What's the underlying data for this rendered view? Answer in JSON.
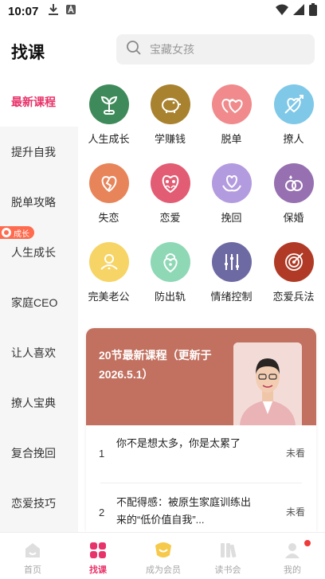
{
  "status_bar": {
    "time": "10:07"
  },
  "header": {
    "title": "找课",
    "search_placeholder": "宝藏女孩"
  },
  "sidebar": {
    "items": [
      {
        "label": "最新课程"
      },
      {
        "label": "提升自我"
      },
      {
        "label": "脱单攻略"
      },
      {
        "label": "人生成长"
      },
      {
        "label": "家庭CEO"
      },
      {
        "label": "让人喜欢"
      },
      {
        "label": "撩人宝典"
      },
      {
        "label": "复合挽回"
      },
      {
        "label": "恋爱技巧"
      }
    ],
    "badge": "成长"
  },
  "categories": [
    {
      "label": "人生成长",
      "icon": "sprout-icon",
      "color": "#3f8a5a"
    },
    {
      "label": "学赚钱",
      "icon": "piggy-bank-icon",
      "color": "#a8822f"
    },
    {
      "label": "脱单",
      "icon": "two-hearts-icon",
      "color": "#f08a8c"
    },
    {
      "label": "撩人",
      "icon": "arrow-heart-icon",
      "color": "#7fc8e8"
    },
    {
      "label": "失恋",
      "icon": "broken-heart-icon",
      "color": "#e8845a"
    },
    {
      "label": "恋爱",
      "icon": "couple-icon",
      "color": "#e25c73"
    },
    {
      "label": "挽回",
      "icon": "heart-hands-icon",
      "color": "#b39be0"
    },
    {
      "label": "保婚",
      "icon": "rings-icon",
      "color": "#9670b0"
    },
    {
      "label": "完美老公",
      "icon": "husband-icon",
      "color": "#f6d465"
    },
    {
      "label": "防出轨",
      "icon": "heart-lock-icon",
      "color": "#8ed8b5"
    },
    {
      "label": "情绪控制",
      "icon": "sliders-icon",
      "color": "#6d6aa3"
    },
    {
      "label": "恋爱兵法",
      "icon": "target-icon",
      "color": "#b03a26"
    }
  ],
  "course_card": {
    "title": "20节最新课程（更新于2026.5.1）",
    "header_color": "#c2705f",
    "lessons": [
      {
        "num": "1",
        "title": "你不是想太多，你是太累了",
        "status": "未看"
      },
      {
        "num": "2",
        "title": "不配得感：被原生家庭训练出来的“低价值自我”...",
        "status": "未看"
      }
    ]
  },
  "bottom_nav": {
    "items": [
      {
        "label": "首页"
      },
      {
        "label": "找课"
      },
      {
        "label": "成为会员"
      },
      {
        "label": "读书会"
      },
      {
        "label": "我的"
      }
    ]
  },
  "colors": {
    "accent": "#e8336a"
  }
}
